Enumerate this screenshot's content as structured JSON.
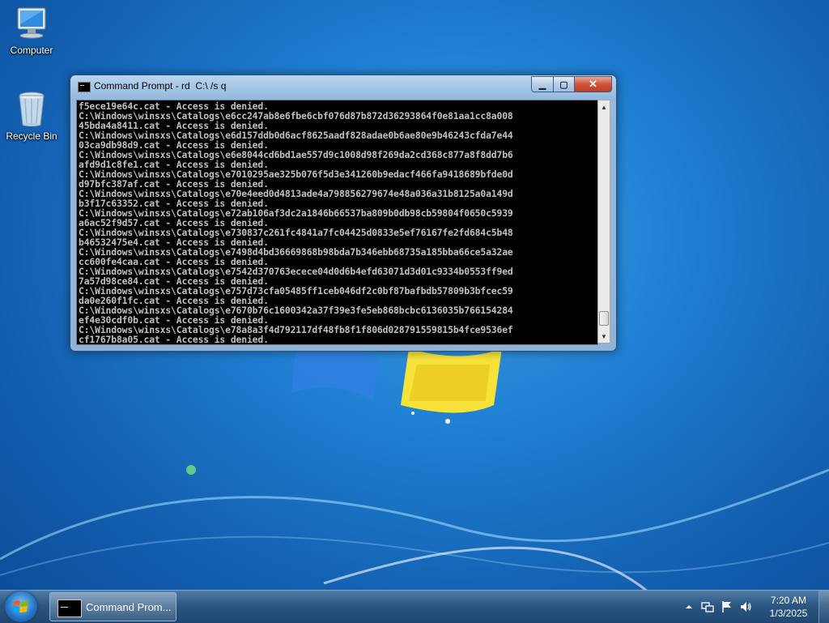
{
  "desktop": {
    "icons": [
      {
        "label": "Computer",
        "icon": "computer-icon"
      },
      {
        "label": "Recycle Bin",
        "icon": "recycle-bin-icon"
      }
    ]
  },
  "window": {
    "title": "Command Prompt - rd  C:\\ /s q",
    "buttons": {
      "minimize": "minimize",
      "maximize": "maximize",
      "close": "close"
    },
    "console_lines": [
      "f5ece19e64c.cat - Access is denied.",
      "C:\\Windows\\winsxs\\Catalogs\\e6cc247ab8e6fbe6cbf076d87b872d36293864f0e81aa1cc8a008",
      "45bda4a8411.cat - Access is denied.",
      "C:\\Windows\\winsxs\\Catalogs\\e6d157ddb0d6acf8625aadf828adae0b6ae80e9b46243cfda7e44",
      "03ca9db98d9.cat - Access is denied.",
      "C:\\Windows\\winsxs\\Catalogs\\e6e8044cd6bd1ae557d9c1008d98f269da2cd368c877a8f8dd7b6",
      "afd9d1c8fe1.cat - Access is denied.",
      "C:\\Windows\\winsxs\\Catalogs\\e7010295ae325b076f5d3e341260b9edacf466fa9418689bfde0d",
      "d97bfc387af.cat - Access is denied.",
      "C:\\Windows\\winsxs\\Catalogs\\e70e4eed0d4813ade4a798856279674e48a036a31b8125a0a149d",
      "b3f17c63352.cat - Access is denied.",
      "C:\\Windows\\winsxs\\Catalogs\\e72ab106af3dc2a1846b66537ba809b0db98cb59804f0650c5939",
      "a6ac52f9d57.cat - Access is denied.",
      "C:\\Windows\\winsxs\\Catalogs\\e730837c261fc4841a7fc04425d0833e5ef76167fe2fd684c5b48",
      "b46532475e4.cat - Access is denied.",
      "C:\\Windows\\winsxs\\Catalogs\\e7498d4bd36669868b98bda7b346ebb68735a185bba66ce5a32ae",
      "cc600fe4caa.cat - Access is denied.",
      "C:\\Windows\\winsxs\\Catalogs\\e7542d370763ecece04d0d6b4efd63071d3d01c9334b0553ff9ed",
      "7a57d98ce84.cat - Access is denied.",
      "C:\\Windows\\winsxs\\Catalogs\\e757d73cfa05485ff1ceb046df2c0bf87bafbdb57809b3bfcec59",
      "da0e260f1fc.cat - Access is denied.",
      "C:\\Windows\\winsxs\\Catalogs\\e7670b76c1600342a37f39e3fe5eb868bcbc6136035b766154284",
      "ef4e30cdf0b.cat - Access is denied.",
      "C:\\Windows\\winsxs\\Catalogs\\e78a8a3f4d792117df48fb8f1f806d028791559815b4fce9536ef",
      "cf1767b8a05.cat - Access is denied."
    ],
    "scroll_position_fraction": 0.98
  },
  "taskbar": {
    "task_button_label": "Command Prom...",
    "tray_icons": [
      "show-hidden-icons-arrow",
      "network-icon",
      "action-center-flag-icon",
      "volume-icon"
    ],
    "clock_time": "7:20 AM",
    "clock_date": "1/3/2025"
  },
  "colors": {
    "console_bg": "#000000",
    "console_fg": "#c0c0c0",
    "close_button": "#c13a1f",
    "desktop_blue": "#1f7fd2"
  }
}
